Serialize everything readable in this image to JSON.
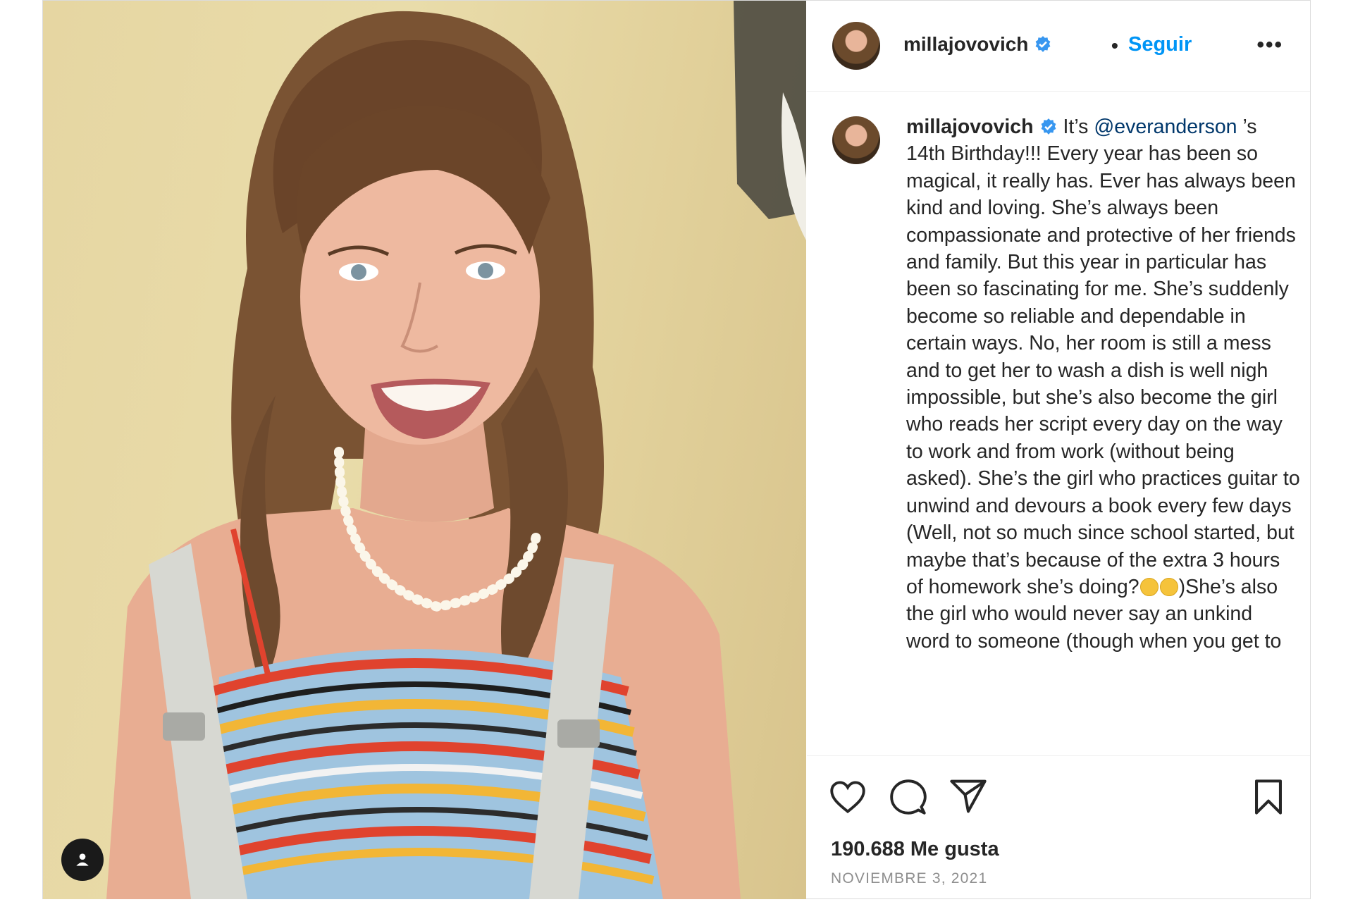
{
  "post": {
    "username": "millajovovich",
    "follow_label": "Seguir",
    "separator": "•",
    "more_label": "•••",
    "caption_username": "millajovovich",
    "caption_prefix": " It’s ",
    "mention": "@everanderson",
    "caption_text": " ’s 14th Birthday!!! Every year has been so magical, it really has. Ever has always been kind and loving. She’s always been compassionate and protective of her friends and family. But this year in particular has been so fascinating for me. She’s suddenly become so reliable and dependable in certain ways. No, her room is still a mess and to get her to wash a dish is well nigh impossible, but she’s also become the girl who reads her script every day on the way to work and from work (without being asked). She’s the girl who practices guitar to unwind and devours a book every few days (Well, not so much since school started, but maybe that’s because of the extra 3 hours of homework she’s doing?",
    "caption_text_2": ")She’s also the girl who would never say an unkind word to someone (though when you get to",
    "likes": "190.688 Me gusta",
    "date": "NOVIEMBRE 3, 2021"
  },
  "icons": {
    "like": "heart-icon",
    "comment": "comment-icon",
    "share": "send-icon",
    "save": "bookmark-icon",
    "verified": "verified-badge-icon",
    "tag": "person-tag-icon"
  },
  "colors": {
    "link": "#0095f6",
    "mention": "#00376b",
    "meta": "#8e8e8e"
  }
}
